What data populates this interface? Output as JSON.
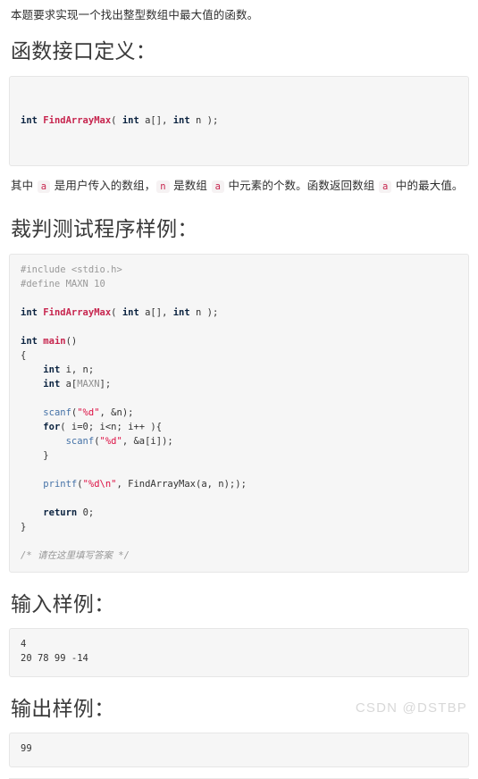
{
  "intro": "本题要求实现一个找出整型数组中最大值的函数。",
  "sections": {
    "function_interface": {
      "heading": "函数接口定义：",
      "signature_tokens": [
        {
          "t": "kw",
          "s": "int"
        },
        {
          "t": "plain",
          "s": " "
        },
        {
          "t": "fn",
          "s": "FindArrayMax"
        },
        {
          "t": "plain",
          "s": "( "
        },
        {
          "t": "kw",
          "s": "int"
        },
        {
          "t": "plain",
          "s": " a[], "
        },
        {
          "t": "kw",
          "s": "int"
        },
        {
          "t": "plain",
          "s": " n );"
        }
      ],
      "signature_plain": "int FindArrayMax( int a[], int n );",
      "description_parts": [
        {
          "type": "text",
          "s": "其中 "
        },
        {
          "type": "code",
          "s": "a"
        },
        {
          "type": "text",
          "s": " 是用户传入的数组，"
        },
        {
          "type": "code",
          "s": "n"
        },
        {
          "type": "text",
          "s": " 是数组 "
        },
        {
          "type": "code",
          "s": "a"
        },
        {
          "type": "text",
          "s": " 中元素的个数。函数返回数组 "
        },
        {
          "type": "code",
          "s": "a"
        },
        {
          "type": "text",
          "s": " 中的最大值。"
        }
      ]
    },
    "judge_program": {
      "heading": "裁判测试程序样例：",
      "code_lines": [
        [
          {
            "t": "pre",
            "s": "#include <stdio.h>"
          }
        ],
        [
          {
            "t": "pre",
            "s": "#define MAXN 10"
          }
        ],
        [],
        [
          {
            "t": "kw",
            "s": "int"
          },
          {
            "t": "plain",
            "s": " "
          },
          {
            "t": "fn",
            "s": "FindArrayMax"
          },
          {
            "t": "plain",
            "s": "( "
          },
          {
            "t": "kw",
            "s": "int"
          },
          {
            "t": "plain",
            "s": " a[], "
          },
          {
            "t": "kw",
            "s": "int"
          },
          {
            "t": "plain",
            "s": " n );"
          }
        ],
        [],
        [
          {
            "t": "kw",
            "s": "int"
          },
          {
            "t": "plain",
            "s": " "
          },
          {
            "t": "fn",
            "s": "main"
          },
          {
            "t": "plain",
            "s": "()"
          }
        ],
        [
          {
            "t": "plain",
            "s": "{"
          }
        ],
        [
          {
            "t": "plain",
            "s": "    "
          },
          {
            "t": "kw",
            "s": "int"
          },
          {
            "t": "plain",
            "s": " i, n;"
          }
        ],
        [
          {
            "t": "plain",
            "s": "    "
          },
          {
            "t": "kw",
            "s": "int"
          },
          {
            "t": "plain",
            "s": " a["
          },
          {
            "t": "macro",
            "s": "MAXN"
          },
          {
            "t": "plain",
            "s": "];"
          }
        ],
        [],
        [
          {
            "t": "plain",
            "s": "    "
          },
          {
            "t": "call",
            "s": "scanf"
          },
          {
            "t": "plain",
            "s": "("
          },
          {
            "t": "str",
            "s": "\"%d\""
          },
          {
            "t": "plain",
            "s": ", &n);"
          }
        ],
        [
          {
            "t": "plain",
            "s": "    "
          },
          {
            "t": "kw",
            "s": "for"
          },
          {
            "t": "plain",
            "s": "( i=0; i<n; i++ ){"
          }
        ],
        [
          {
            "t": "plain",
            "s": "        "
          },
          {
            "t": "call",
            "s": "scanf"
          },
          {
            "t": "plain",
            "s": "("
          },
          {
            "t": "str",
            "s": "\"%d\""
          },
          {
            "t": "plain",
            "s": ", &a[i]);"
          }
        ],
        [
          {
            "t": "plain",
            "s": "    }"
          }
        ],
        [],
        [
          {
            "t": "plain",
            "s": "    "
          },
          {
            "t": "call",
            "s": "printf"
          },
          {
            "t": "plain",
            "s": "("
          },
          {
            "t": "str",
            "s": "\"%d\\n\""
          },
          {
            "t": "plain",
            "s": ", FindArrayMax(a, n););"
          }
        ],
        [],
        [
          {
            "t": "plain",
            "s": "    "
          },
          {
            "t": "kw",
            "s": "return"
          },
          {
            "t": "plain",
            "s": " "
          },
          {
            "t": "num",
            "s": "0"
          },
          {
            "t": "plain",
            "s": ";"
          }
        ],
        [
          {
            "t": "plain",
            "s": "}"
          }
        ],
        [],
        [
          {
            "t": "cmt",
            "s": "/* 请在这里填写答案 */"
          }
        ]
      ]
    },
    "input_sample": {
      "heading": "输入样例：",
      "lines": [
        "4",
        "20 78 99 -14"
      ]
    },
    "output_sample": {
      "heading": "输出样例：",
      "lines": [
        "99"
      ]
    }
  },
  "watermark": "CSDN @DSTBP",
  "colors": {
    "code_bg": "#f6f6f6",
    "code_border": "#e6e6e6",
    "keyword": "#0b2340",
    "function_name": "#c7254e",
    "library_call": "#4572a7",
    "string": "#d14",
    "preprocessor": "#999999",
    "comment": "#999999",
    "inline_chip_text": "#c7254e",
    "inline_chip_bg": "#f6f2f3",
    "heading": "#3a3a3a",
    "body_text": "#2f2f2f",
    "watermark": "#d8d8d8"
  }
}
